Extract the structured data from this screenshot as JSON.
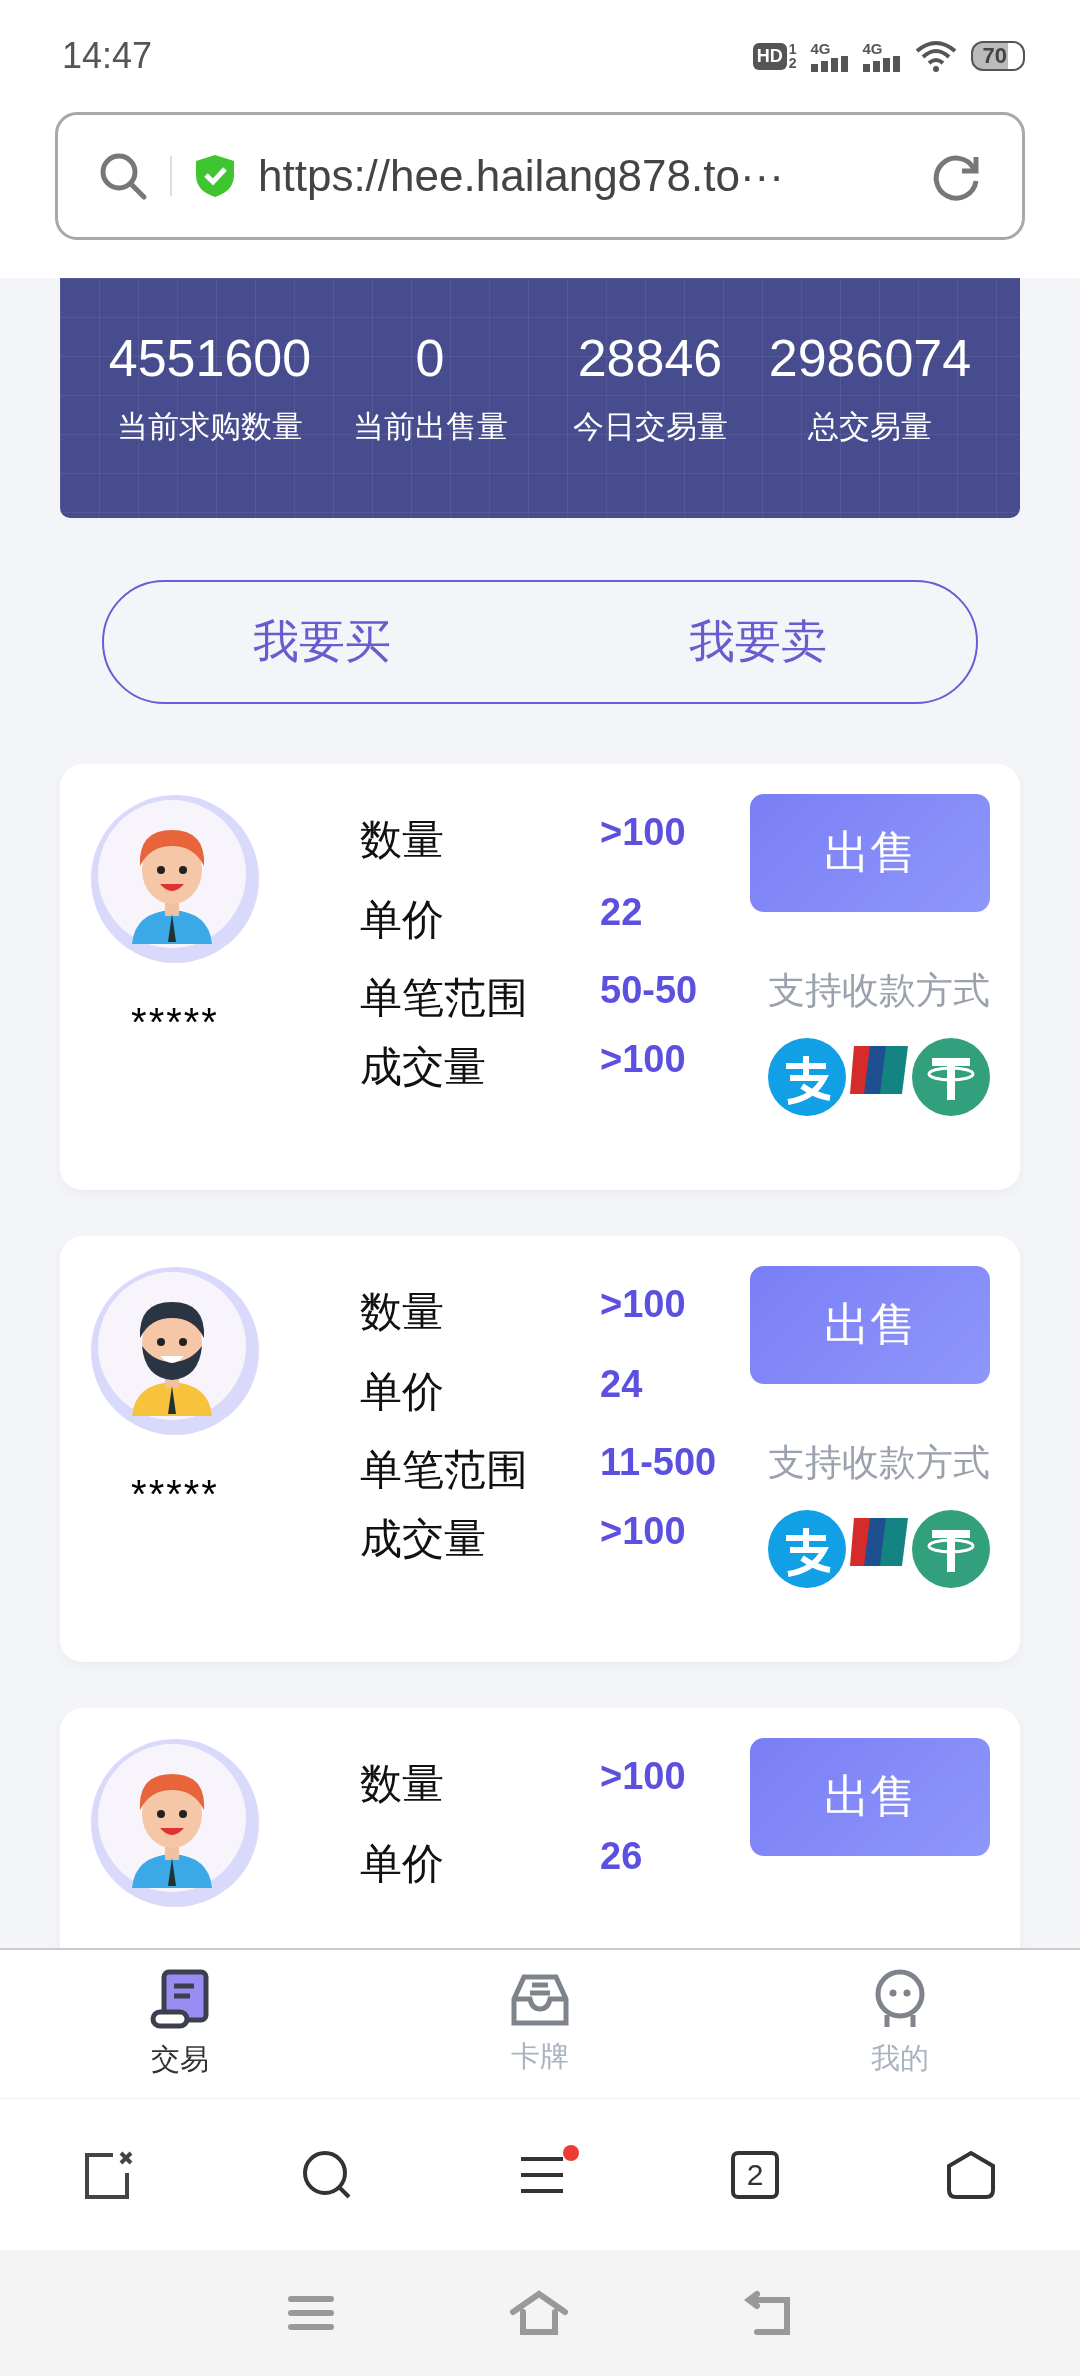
{
  "status_bar": {
    "time": "14:47",
    "hd": {
      "label": "HD",
      "slots": [
        "1",
        "2"
      ]
    },
    "signals": [
      {
        "label": "4G"
      },
      {
        "label": "4G"
      }
    ],
    "battery": "70"
  },
  "address_bar": {
    "url": "https://hee.hailang878.to···"
  },
  "stats": [
    {
      "value": "4551600",
      "label": "当前求购数量"
    },
    {
      "value": "0",
      "label": "当前出售量"
    },
    {
      "value": "28846",
      "label": "今日交易量"
    },
    {
      "value": "2986074",
      "label": "总交易量"
    }
  ],
  "mode_toggle": [
    {
      "label": "我要买"
    },
    {
      "label": "我要卖"
    }
  ],
  "listings": [
    {
      "avatar": {
        "kind": "redhead"
      },
      "name": "*****",
      "rows": [
        {
          "label": "数量",
          "value": ">100"
        },
        {
          "label": "单价",
          "value": "22"
        },
        {
          "label": "单笔范围",
          "value": "50-50"
        },
        {
          "label": "成交量",
          "value": ">100"
        }
      ],
      "action": "出售",
      "payment_label": "支持收款方式",
      "payments": [
        {
          "kind": "round"
        },
        {
          "kind": "card"
        },
        {
          "kind": "coin"
        }
      ]
    },
    {
      "avatar": {
        "kind": "bearded"
      },
      "name": "*****",
      "rows": [
        {
          "label": "数量",
          "value": ">100"
        },
        {
          "label": "单价",
          "value": "24"
        },
        {
          "label": "单笔范围",
          "value": "11-500"
        },
        {
          "label": "成交量",
          "value": ">100"
        }
      ],
      "action": "出售",
      "payment_label": "支持收款方式",
      "payments": [
        {
          "kind": "round"
        },
        {
          "kind": "card"
        },
        {
          "kind": "coin"
        }
      ]
    },
    {
      "avatar": {
        "kind": "redhead"
      },
      "rows": [
        {
          "label": "数量",
          "value": ">100"
        },
        {
          "label": "单价",
          "value": "26"
        }
      ],
      "action": "出售"
    }
  ],
  "tab_bar": [
    {
      "label": "交易",
      "kind": "scroll",
      "selected": true
    },
    {
      "label": "卡牌",
      "kind": "tray",
      "selected": false
    },
    {
      "label": "我的",
      "kind": "face",
      "selected": false
    }
  ],
  "browser_toolbar": {
    "tab_count": "2",
    "menu_notification": true
  },
  "system_nav": [
    {
      "kind": "menu"
    },
    {
      "kind": "home"
    },
    {
      "kind": "back"
    }
  ]
}
